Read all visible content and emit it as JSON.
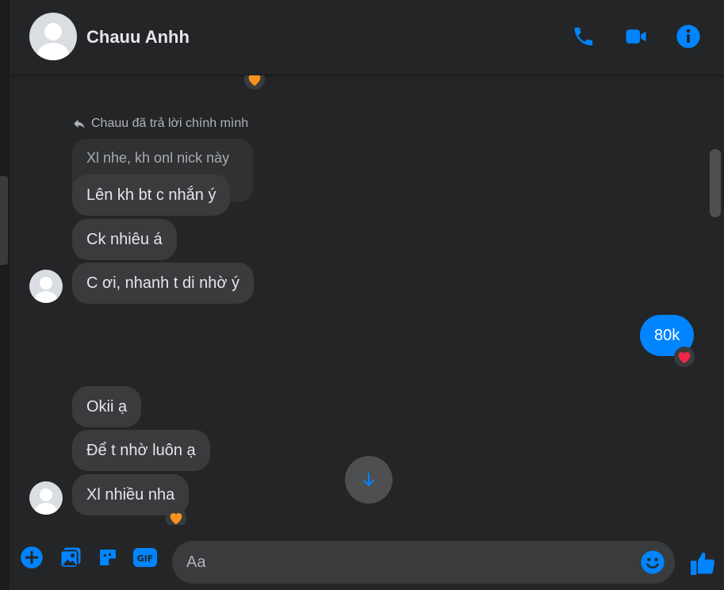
{
  "header": {
    "contact_name": "Chauu Anhh",
    "icons": [
      "phone-icon",
      "video-camera-icon",
      "info-icon"
    ]
  },
  "colors": {
    "accent": "#0084ff",
    "incoming_bubble": "#3a3b3c",
    "background": "#242526"
  },
  "messages": {
    "reply_label": "Chauu đã trả lời chính mình",
    "quoted_text": "Xl nhe, kh onl nick này",
    "incoming_1": [
      "Lên kh bt c nhắn ý",
      "Ck nhiêu á",
      "C ơi, nhanh t di nhờ ý"
    ],
    "outgoing": "80k",
    "incoming_2": [
      "Okii ạ",
      "Để t nhờ luôn ạ",
      "Xl nhiều nha"
    ],
    "reactions": [
      "orange-heart",
      "red-heart",
      "orange-heart"
    ]
  },
  "composer": {
    "placeholder": "Aa",
    "icons": [
      "plus-icon",
      "photo-icon",
      "sticker-icon",
      "gif-icon",
      "emoji-icon",
      "thumbs-up-icon"
    ]
  }
}
